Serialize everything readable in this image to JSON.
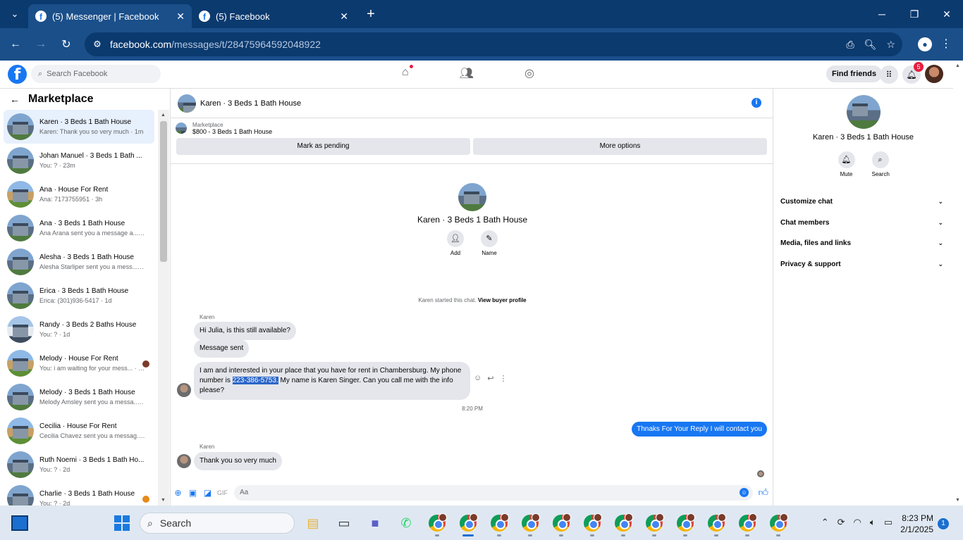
{
  "browser": {
    "tabs": [
      {
        "label": "(5) Messenger | Facebook",
        "active": true
      },
      {
        "label": "(5) Facebook",
        "active": false
      }
    ],
    "url_domain": "facebook.com",
    "url_path": "/messages/t/28475964592048922"
  },
  "fb": {
    "search_placeholder": "Search Facebook",
    "find_friends": "Find friends",
    "notif_count": "5"
  },
  "sidebar": {
    "title": "Marketplace",
    "conversations": [
      {
        "title": "Karen · 3 Beds 1 Bath House",
        "sub": "Karen: Thank you so very much · 1m"
      },
      {
        "title": "Johan Manuel · 3 Beds 1 Bath ...",
        "sub": "You: ? · 23m"
      },
      {
        "title": "Ana · House For Rent",
        "sub": "Ana: 7173755951 · 3h"
      },
      {
        "title": "Ana · 3 Beds 1 Bath House",
        "sub": "Ana Arana sent you a message a... · 3h"
      },
      {
        "title": "Alesha · 3 Beds 1 Bath House",
        "sub": "Alesha Starliper sent you a mess... · 23h"
      },
      {
        "title": "Erica · 3 Beds 1 Bath House",
        "sub": "Erica: (301)936-5417 · 1d"
      },
      {
        "title": "Randy · 3 Beds 2 Baths House",
        "sub": "You: ? · 1d"
      },
      {
        "title": "Melody · House For Rent",
        "sub": "You: i am waiting for your mess... · 1d"
      },
      {
        "title": "Melody · 3 Beds 1 Bath House",
        "sub": "Melody Amsley sent you a messa... · 1d"
      },
      {
        "title": "Cecilia · House For Rent",
        "sub": "Cecilia Chavez sent you a messag... · 1d"
      },
      {
        "title": "Ruth Noemi · 3 Beds 1 Bath Ho...",
        "sub": "You: ? · 2d"
      },
      {
        "title": "Charlie · 3 Beds 1 Bath House",
        "sub": "You: ? · 2d"
      }
    ]
  },
  "chat": {
    "title": "Karen · 3 Beds 1 Bath House",
    "marketplace_label": "Marketplace",
    "listing": "$800 - 3 Beds 1 Bath House",
    "btn_pending": "Mark as pending",
    "btn_more": "More options",
    "profile_name": "Karen · 3 Beds 1 Bath House",
    "act_add": "Add",
    "act_name": "Name",
    "started_text": "Karen started this chat.",
    "started_link": "View buyer profile",
    "sender": "Karen",
    "msg1": "Hi Julia, is this still available?",
    "msg2": "Message sent",
    "msg3_pre": "I am and interested in your place that you have for rent in Chambersburg. My phone number is ",
    "msg3_phone": "223-386-5753.",
    "msg3_post": " My name is Karen Singer. Can you call me with the info please?",
    "time": "8:20 PM",
    "outgoing": "Thnaks For Your Reply I will contact you",
    "sender2": "Karen",
    "msg4": "Thank you so very much",
    "composer_placeholder": "Aa"
  },
  "details": {
    "name": "Karen · 3 Beds 1 Bath House",
    "mute": "Mute",
    "search": "Search",
    "menu": [
      "Customize chat",
      "Chat members",
      "Media, files and links",
      "Privacy & support"
    ]
  },
  "taskbar": {
    "search": "Search",
    "time": "8:23 PM",
    "date": "2/1/2025",
    "badge": "1"
  }
}
